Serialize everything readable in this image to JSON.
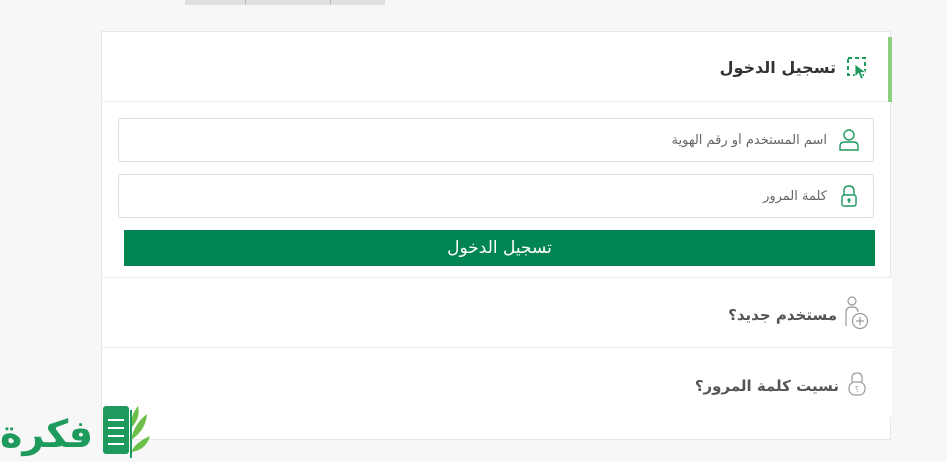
{
  "login": {
    "header_title": "تسجيل الدخول",
    "username": {
      "placeholder": "اسم المستخدم أو رقم الهوية",
      "value": ""
    },
    "password": {
      "placeholder": "كلمة المرور",
      "value": ""
    },
    "submit_label": "تسجيل الدخول"
  },
  "links": {
    "new_user": "مستخدم جديد؟",
    "forgot_password": "نسيت كلمة المرور؟"
  },
  "logo": {
    "text": "فكرة"
  },
  "colors": {
    "primary_green": "#008452",
    "accent_light_green": "#8ad07f",
    "icon_green": "#1f9a5d"
  }
}
